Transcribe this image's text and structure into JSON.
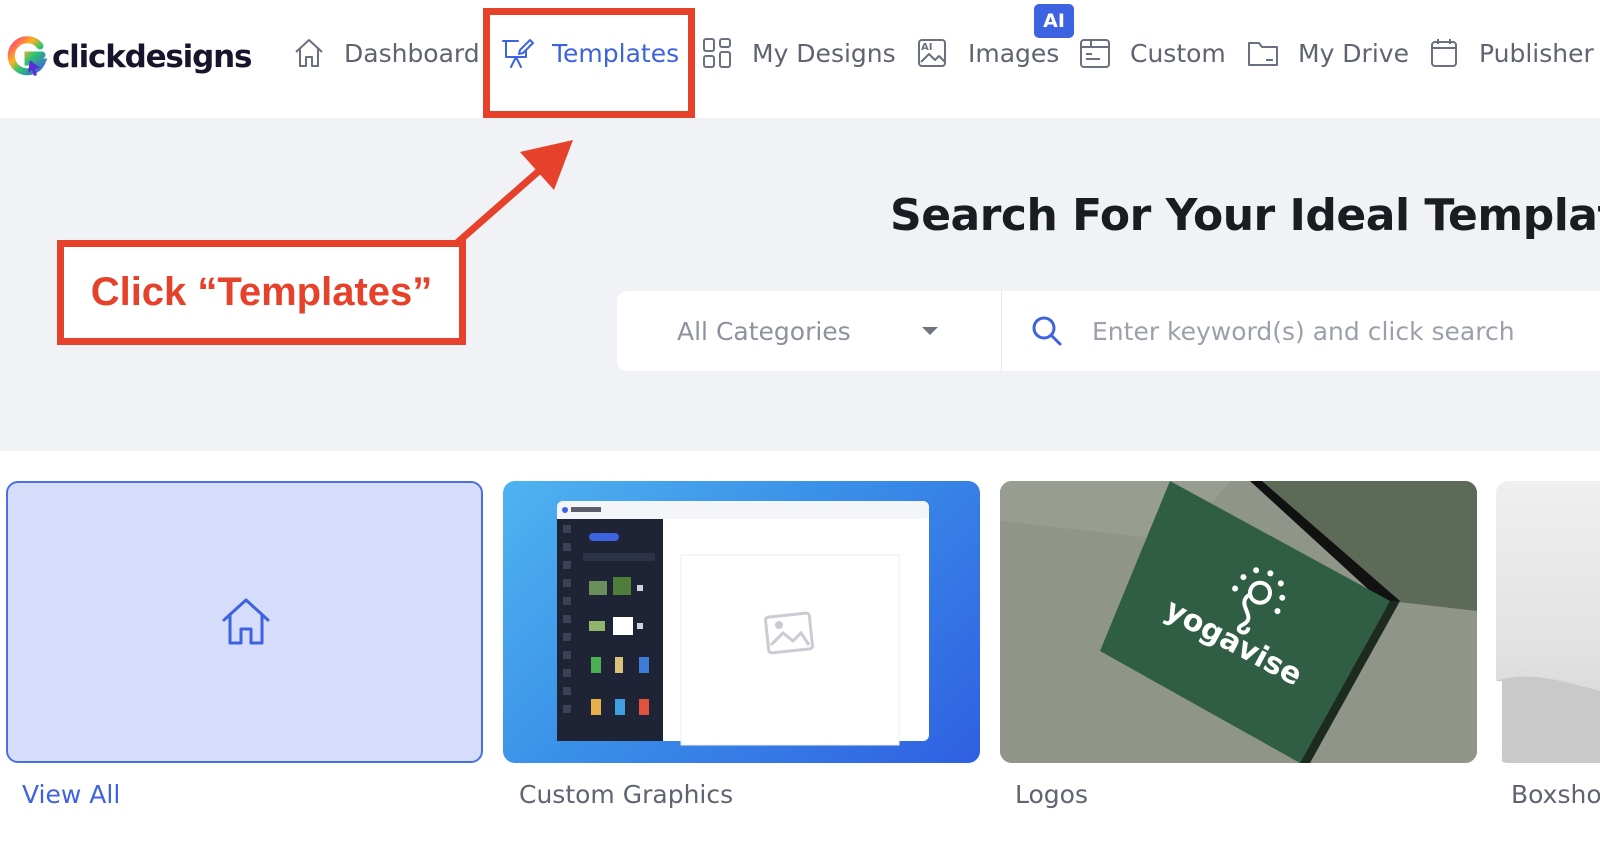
{
  "brand": {
    "name": "clickdesigns"
  },
  "nav": {
    "items": [
      {
        "label": "Dashboard",
        "icon": "home-icon",
        "active": false
      },
      {
        "label": "Templates",
        "icon": "templates-icon",
        "active": true
      },
      {
        "label": "My Designs",
        "icon": "grid-icon",
        "active": false
      },
      {
        "label": "Images",
        "icon": "image-ai-icon",
        "active": false,
        "badge": "AI"
      },
      {
        "label": "Custom",
        "icon": "custom-icon",
        "active": false
      },
      {
        "label": "My Drive",
        "icon": "folder-icon",
        "active": false
      },
      {
        "label": "Publisher",
        "icon": "calendar-icon",
        "active": false
      }
    ]
  },
  "hero": {
    "title": "Search For Your Ideal Template",
    "category_select": "All Categories",
    "search_placeholder": "Enter keyword(s) and click search"
  },
  "cards": [
    {
      "label": "View All",
      "icon": "home-icon"
    },
    {
      "label": "Custom Graphics"
    },
    {
      "label": "Logos",
      "image_text": "yogavise"
    },
    {
      "label": "Boxsho"
    }
  ],
  "annotation": {
    "callout": "Click “Templates”",
    "color": "#e6412a"
  },
  "colors": {
    "accent": "#3d63e0",
    "hero_bg": "#f1f2f5"
  }
}
